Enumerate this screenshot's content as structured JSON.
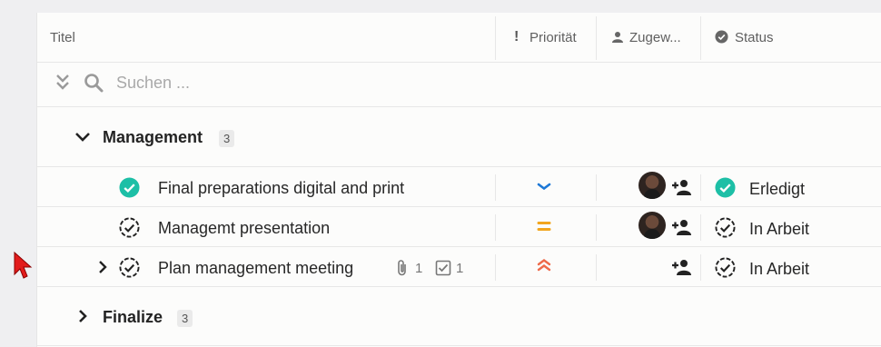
{
  "header": {
    "title_col": "Titel",
    "priority_col": "Priorität",
    "assignee_col": "Zugew...",
    "status_col": "Status",
    "priority_icon": "!"
  },
  "search": {
    "placeholder": "Suchen ..."
  },
  "groups": [
    {
      "name": "Management",
      "count": "3",
      "tasks": [
        {
          "title": "Final preparations digital and print",
          "priority": "low",
          "status": "Erledigt",
          "status_kind": "done",
          "has_avatar": true
        },
        {
          "title": "Managemt presentation",
          "priority": "medium",
          "status": "In Arbeit",
          "status_kind": "in-progress",
          "has_avatar": true
        },
        {
          "title": "Plan management meeting",
          "priority": "high",
          "status": "In Arbeit",
          "status_kind": "in-progress",
          "has_avatar": false,
          "attachments": "1",
          "subtasks": "1"
        }
      ]
    },
    {
      "name": "Finalize",
      "count": "3"
    }
  ],
  "colors": {
    "done": "#1dbfa6",
    "priority_low": "#1d78d6",
    "priority_medium": "#f2a51d",
    "priority_high": "#ee6a4a"
  }
}
